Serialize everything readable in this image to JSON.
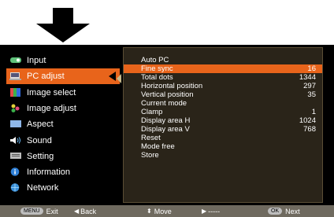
{
  "sidebar": {
    "items": [
      {
        "label": "Input",
        "icon": "input-icon",
        "color": "#5fc27a"
      },
      {
        "label": "PC adjust",
        "icon": "pc-adjust-icon",
        "color": "#d0d0d0"
      },
      {
        "label": "Image select",
        "icon": "image-select-icon",
        "color": "#2f9be0"
      },
      {
        "label": "Image adjust",
        "icon": "image-adjust-icon",
        "color": "#e04a7a"
      },
      {
        "label": "Aspect",
        "icon": "aspect-icon",
        "color": "#8fb7e8"
      },
      {
        "label": "Sound",
        "icon": "sound-icon",
        "color": "#6ec1ff"
      },
      {
        "label": "Setting",
        "icon": "setting-icon",
        "color": "#bbbbbb"
      },
      {
        "label": "Information",
        "icon": "information-icon",
        "color": "#2e7fd6"
      },
      {
        "label": "Network",
        "icon": "network-icon",
        "color": "#3a8fd8"
      }
    ]
  },
  "panel": {
    "rows": [
      {
        "label": "Auto PC",
        "value": ""
      },
      {
        "label": "Fine sync",
        "value": "16"
      },
      {
        "label": "Total dots",
        "value": "1344"
      },
      {
        "label": "Horizontal position",
        "value": "297"
      },
      {
        "label": "Vertical position",
        "value": "35"
      },
      {
        "label": "Current mode",
        "value": ""
      },
      {
        "label": "Clamp",
        "value": "1"
      },
      {
        "label": "Display area H",
        "value": "1024"
      },
      {
        "label": "Display area V",
        "value": "768"
      },
      {
        "label": "Reset",
        "value": ""
      },
      {
        "label": "Mode free",
        "value": ""
      },
      {
        "label": "Store",
        "value": ""
      }
    ]
  },
  "footer": {
    "exit_key": "MENU",
    "exit_label": "Exit",
    "back_label": "Back",
    "move_label": "Move",
    "dashes_label": "-----",
    "next_key": "OK",
    "next_label": "Next"
  },
  "colors": {
    "accent": "#e8641b",
    "panel_bg": "#2a2419",
    "footer_bg": "#6f6a5f"
  }
}
